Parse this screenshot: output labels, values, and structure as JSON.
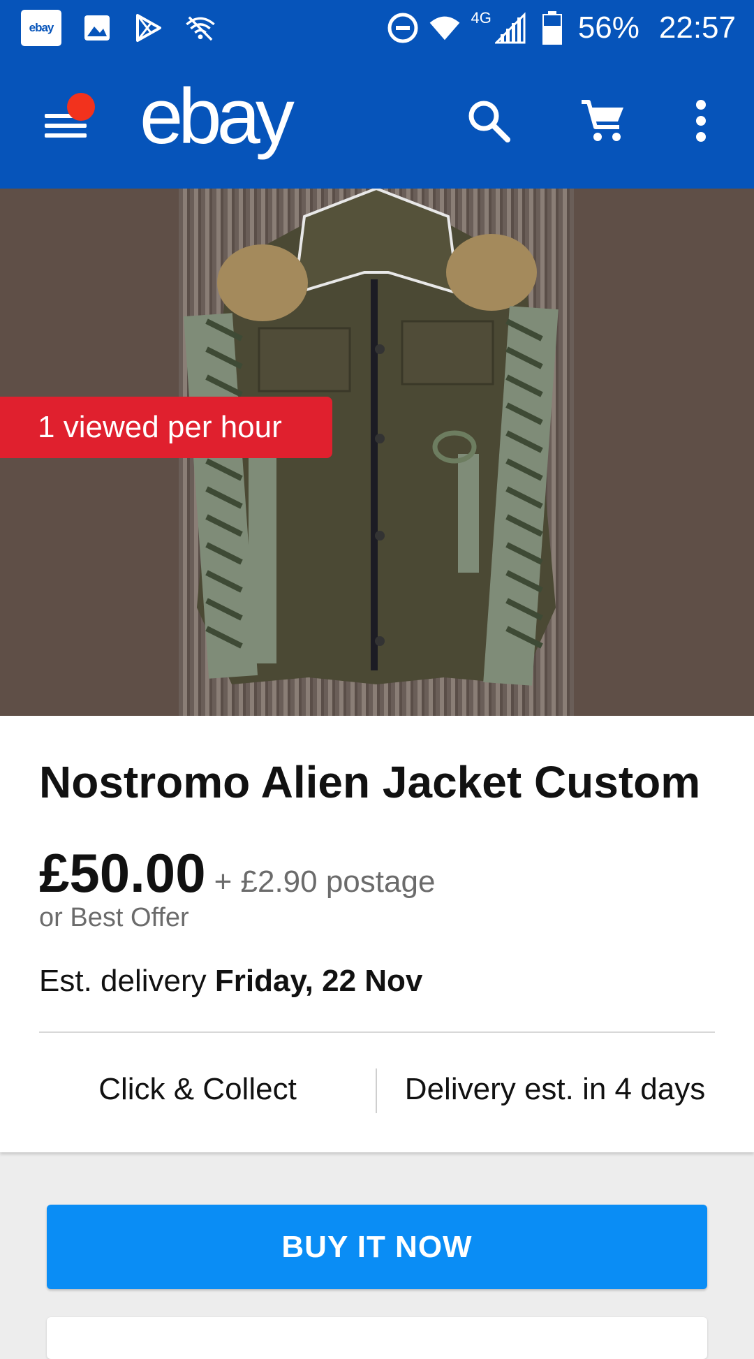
{
  "status_bar": {
    "app_badge": "ebay",
    "network_label": "4G",
    "battery": "56%",
    "time": "22:57",
    "icons": [
      "ebay-badge",
      "image-icon",
      "play-store-icon",
      "wifi-off-icon",
      "dnd-icon",
      "wifi-icon",
      "signal-icon",
      "battery-icon"
    ]
  },
  "app_bar": {
    "logo": "ebay",
    "icons": [
      "menu-icon",
      "search-icon",
      "cart-icon",
      "more-vert-icon"
    ],
    "color": "#0654ba",
    "notification_dot_color": "#f2321d"
  },
  "hero": {
    "badge": "1 viewed per hour",
    "badge_color": "#e0202e"
  },
  "listing": {
    "title": "Nostromo Alien Jacket Custom",
    "price": "£50.00",
    "postage": "+ £2.90 postage",
    "best_offer": "or Best Offer",
    "delivery_prefix": "Est. delivery",
    "delivery_date": "Friday, 22 Nov",
    "option_left": "Click & Collect",
    "option_right": "Delivery est. in 4 days"
  },
  "actions": {
    "buy_now": "BUY IT NOW",
    "buy_now_color": "#0a8df5"
  }
}
